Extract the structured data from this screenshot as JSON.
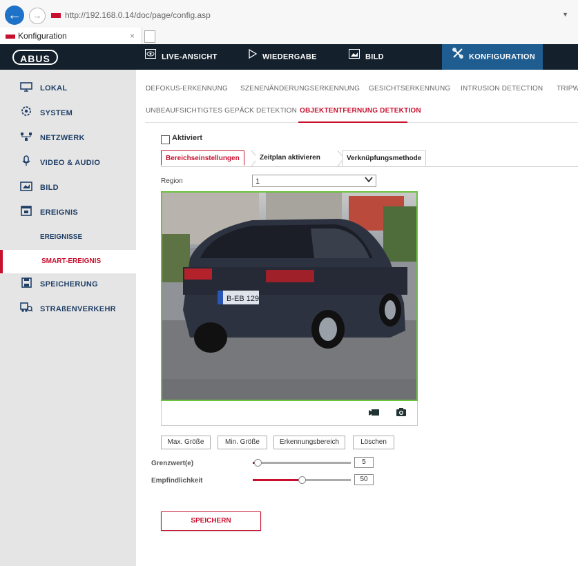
{
  "browser": {
    "url": "http://192.168.0.14/doc/page/config.asp",
    "tab_title": "Konfiguration",
    "tab_close": "×"
  },
  "topnav": {
    "logo": "ABUS",
    "items": [
      {
        "label": "LIVE-ANSICHT",
        "icon": "eye-icon"
      },
      {
        "label": "WIEDERGABE",
        "icon": "play-icon"
      },
      {
        "label": "BILD",
        "icon": "image-icon"
      },
      {
        "label": "KONFIGURATION",
        "icon": "tools-icon"
      }
    ],
    "active": "KONFIGURATION",
    "active_color": "#1f5c8f"
  },
  "sidebar": {
    "items": [
      {
        "label": "LOKAL",
        "icon": "monitor-icon"
      },
      {
        "label": "SYSTEM",
        "icon": "gear-icon"
      },
      {
        "label": "NETZWERK",
        "icon": "network-icon"
      },
      {
        "label": "VIDEO & AUDIO",
        "icon": "microphone-icon"
      },
      {
        "label": "BILD",
        "icon": "image-icon"
      },
      {
        "label": "EREIGNIS",
        "icon": "calendar-icon"
      },
      {
        "label": "SPEICHERUNG",
        "icon": "save-icon"
      },
      {
        "label": "STRAßENVERKEHR",
        "icon": "vehicle-icon"
      }
    ],
    "sub_items": [
      "EREIGNISSE",
      "SMART-EREIGNIS"
    ],
    "active_sub": "SMART-EREIGNIS"
  },
  "subtabs": {
    "row1": [
      "DEFOKUS-ERKENNUNG",
      "SZENENÄNDERUNGSERKENNUNG",
      "GESICHTSERKENNUNG",
      "INTRUSION DETECTION",
      "TRIPW"
    ],
    "row2": [
      "UNBEAUFSICHTIGTES GEPÄCK DETEKTION",
      "OBJEKTENTFERNUNG DETEKTION"
    ],
    "active": "OBJEKTENTFERNUNG DETEKTION"
  },
  "form": {
    "aktiviert_label": "Aktiviert",
    "aktiviert_checked": false,
    "step_tabs": [
      "Bereichseinstellungen",
      "Zeitplan aktivieren",
      "Verknüpfungsmethode"
    ],
    "active_step": "Bereichseinstellungen",
    "region_label": "Region",
    "region_value": "1",
    "plate_text": "B-EB 129",
    "buttons": {
      "max": "Max. Größe",
      "min": "Min. Größe",
      "area": "Erkennungsbereich",
      "delete": "Löschen"
    },
    "threshold": {
      "label": "Grenzwert(e)",
      "value": "5",
      "fraction": 0.05
    },
    "sensitivity": {
      "label": "Empfindlichkeit",
      "value": "50",
      "fraction": 0.5
    },
    "save": "SPEICHERN"
  },
  "colors": {
    "accent": "#c8102e",
    "nav_bg": "#14202c",
    "roi_border": "#6bc23d"
  }
}
